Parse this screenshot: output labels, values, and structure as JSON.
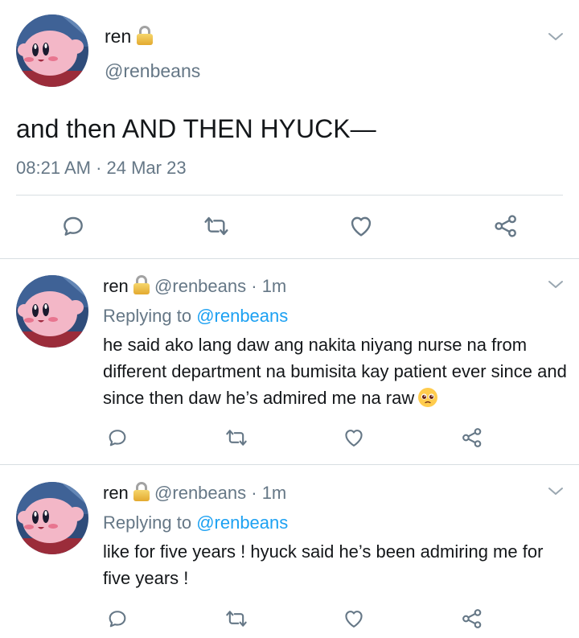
{
  "main_tweet": {
    "name": "ren",
    "handle": "@renbeans",
    "text": "and then AND THEN HYUCK—",
    "timestamp": "08:21 AM · 24 Mar 23"
  },
  "replies": [
    {
      "name": "ren",
      "handle": "@renbeans",
      "separator": " · ",
      "time": "1m",
      "replying_prefix": "Replying to ",
      "replying_handle": "@renbeans",
      "text": "he said ako lang daw ang nakita niyang nurse na from different department na bumisita kay patient ever since and since then daw he’s admired me na raw",
      "trailing_emoji": "pleading-face-emoji"
    },
    {
      "name": "ren",
      "handle": "@renbeans",
      "separator": " · ",
      "time": "1m",
      "replying_prefix": "Replying to ",
      "replying_handle": "@renbeans",
      "text": "like for five years ! hyuck said he’s been admiring me for five years !"
    }
  ],
  "icons": {
    "reply": "comment-icon",
    "retweet": "retweet-icon",
    "like": "heart-icon",
    "share": "share-icon",
    "more": "chevron-down-icon",
    "protected": "lock-icon"
  },
  "colors": {
    "text": "#14171a",
    "muted": "#657786",
    "link": "#1da1f2",
    "divider": "#d8dee2",
    "icon": "#657786"
  }
}
